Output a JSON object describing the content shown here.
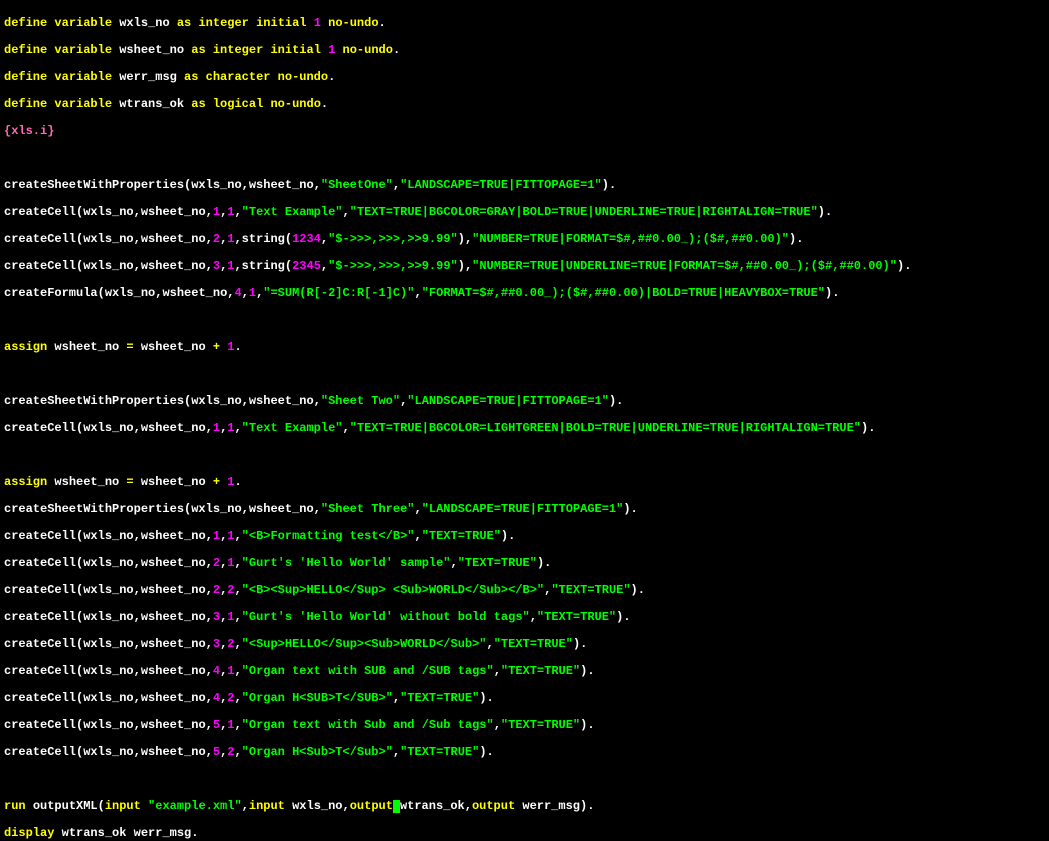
{
  "kw": {
    "define": "define",
    "variable": "variable",
    "as": "as",
    "integer": "integer",
    "initial": "initial",
    "noundo": "no-undo",
    "character": "character",
    "logical": "logical",
    "assign": "assign",
    "run": "run",
    "input": "input",
    "output": "output",
    "display": "display"
  },
  "ids": {
    "wxls_no": "wxls_no",
    "wsheet_no": "wsheet_no",
    "werr_msg": "werr_msg",
    "wtrans_ok": "wtrans_ok",
    "outputXML": "outputXML",
    "createSheetWithProperties": "createSheetWithProperties",
    "createCell": "createCell",
    "createFormula": "createFormula",
    "string": "string"
  },
  "braces": "{xls.i}",
  "nums": {
    "one": "1",
    "two": "2",
    "three": "3",
    "four": "4",
    "five": "5",
    "n1234": "1234",
    "n2345": "2345"
  },
  "s": {
    "SheetOne": "\"SheetOne\"",
    "LandFit": "\"LANDSCAPE=TRUE|FITTOPAGE=1\"",
    "TextExample": "\"Text Example\"",
    "TextBgGray": "\"TEXT=TRUE|BGCOLOR=GRAY|BOLD=TRUE|UNDERLINE=TRUE|RIGHTALIGN=TRUE\"",
    "NumFmt": "\"$->>>,>>>,>>9.99\"",
    "NumberTrueFmt": "\"NUMBER=TRUE|FORMAT=$#,##0.00_);($#,##0.00)\"",
    "NumberTrueUnderlineFmt": "\"NUMBER=TRUE|UNDERLINE=TRUE|FORMAT=$#,##0.00_);($#,##0.00)\"",
    "SumFormula": "\"=SUM(R[-2]C:R[-1]C)\"",
    "FormulaFmt": "\"FORMAT=$#,##0.00_);($#,##0.00)|BOLD=TRUE|HEAVYBOX=TRUE\"",
    "SheetTwo": "\"Sheet Two\"",
    "TextBgLightGreen": "\"TEXT=TRUE|BGCOLOR=LIGHTGREEN|BOLD=TRUE|UNDERLINE=TRUE|RIGHTALIGN=TRUE\"",
    "SheetThree": "\"Sheet Three\"",
    "FmtTest": "\"<B>Formatting test</B>\"",
    "TextTrue": "\"TEXT=TRUE\"",
    "GurtHello": "\"Gurt's 'Hello World' sample\"",
    "BSupHello": "\"<B><Sup>HELLO</Sup> <Sub>WORLD</Sub></B>\"",
    "GurtNoBold": "\"Gurt's 'Hello World' without bold tags\"",
    "SupHello": "\"<Sup>HELLO</Sup><Sub>WORLD</Sub>\"",
    "OrganSUB": "\"Organ text with SUB and /SUB tags\"",
    "OrganHSUB": "\"Organ H<SUB>T</SUB>\"",
    "OrganSub": "\"Organ text with Sub and /Sub tags\"",
    "OrganHSubL": "\"Organ H<Sub>T</Sub>\"",
    "ExampleXml": "\"example.xml\""
  },
  "ops": {
    "eq": " = ",
    "plus": " + ",
    "dot": ".",
    "comma": ",",
    "lp": "(",
    "rp": ")"
  }
}
